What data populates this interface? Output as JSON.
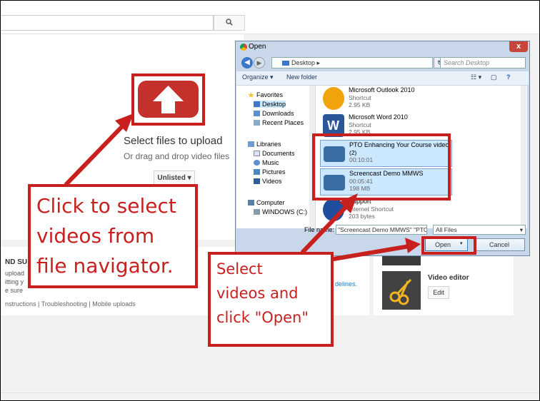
{
  "youtube": {
    "upload_title": "Select files to upload",
    "upload_subtitle": "Or drag and drop video files",
    "privacy_label": "Unlisted",
    "import": {
      "heading": "ND SU",
      "lines": [
        "upload",
        "itting y",
        "e sure"
      ],
      "links": "nstructions    |    Troubleshooting    |    Mobile uploads",
      "guidelines_link": "delines."
    },
    "side": {
      "editor_title": "Video editor",
      "editor_button": "Edit"
    }
  },
  "dialog": {
    "title": "Open",
    "close": "x",
    "address": "Desktop",
    "search_placeholder": "Search Desktop",
    "toolbar": {
      "organize": "Organize",
      "new_folder": "New folder"
    },
    "nav": [
      {
        "label": "Favorites",
        "icon": "star-icon",
        "group": true
      },
      {
        "label": "Desktop",
        "icon": "desktop-icon",
        "selected": true
      },
      {
        "label": "Downloads",
        "icon": "downloads-icon"
      },
      {
        "label": "Recent Places",
        "icon": "recent-places-icon"
      },
      {
        "label": "Libraries",
        "icon": "library-icon",
        "group": true
      },
      {
        "label": "Documents",
        "icon": "documents-icon"
      },
      {
        "label": "Music",
        "icon": "music-icon"
      },
      {
        "label": "Pictures",
        "icon": "pictures-icon"
      },
      {
        "label": "Videos",
        "icon": "videos-icon"
      },
      {
        "label": "Computer",
        "icon": "computer-icon",
        "group": true
      },
      {
        "label": "WINDOWS (C:)",
        "icon": "drive-icon"
      }
    ],
    "files": [
      {
        "name": "Microsoft Outlook 2010",
        "meta1": "Shortcut",
        "meta2": "2.95 KB",
        "icon": "outlook-icon",
        "color": "#f0a30a",
        "selected": false
      },
      {
        "name": "Microsoft Word 2010",
        "meta1": "Shortcut",
        "meta2": "2.95 KB",
        "icon": "word-icon",
        "color": "#2b579a",
        "selected": false
      },
      {
        "name": "PTO Enhancing Your Course video",
        "meta1": "(2)",
        "meta2": "00:10:01",
        "icon": "video-thumb-icon",
        "color": "#3a6ea5",
        "selected": true
      },
      {
        "name": "Screencast Demo MMWS",
        "meta1": "00:05:41",
        "meta2": "198 MB",
        "icon": "video-thumb-icon",
        "color": "#3a6ea5",
        "selected": true
      },
      {
        "name": "Support",
        "meta1": "Internet Shortcut",
        "meta2": "203 bytes",
        "icon": "support-icon",
        "color": "#1f4e9e",
        "selected": false
      }
    ],
    "file_name_label": "File name:",
    "file_name_value": "\"Screencast Demo MMWS\" \"PTO E",
    "filter": "All Files",
    "open_button": "Open",
    "cancel_button": "Cancel"
  },
  "annotations": {
    "callout_left": [
      "Click to select",
      "videos from",
      "file navigator."
    ],
    "callout_right": [
      "Select",
      "videos and",
      "click \"Open\""
    ],
    "accent": "#c8201f"
  }
}
